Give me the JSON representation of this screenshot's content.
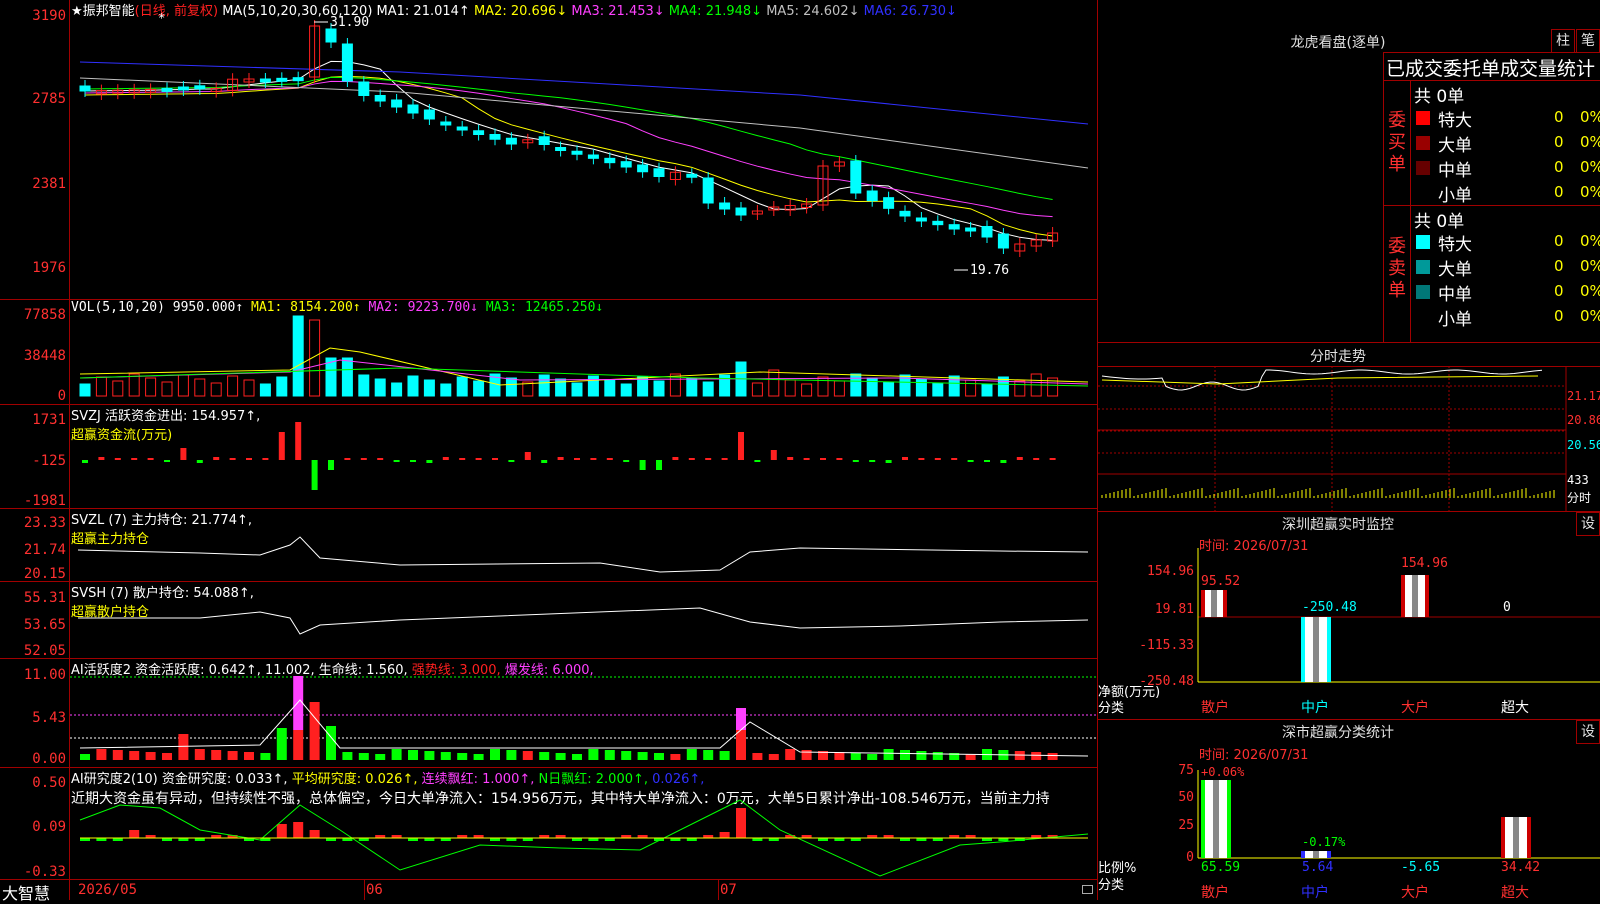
{
  "colors": {
    "up": "#ff2020",
    "down": "#00ffff",
    "ma1": "#ffffff",
    "ma2": "#ffff00",
    "ma3": "#ff40ff",
    "ma4": "#00ff00",
    "ma5": "#c0c0c0",
    "ma6": "#3030ff"
  },
  "main": {
    "title": "★振邦智能",
    "period": "(日线, 前复权)",
    "ma_label": "MA(5,10,20,30,60,120)",
    "ma1": "MA1: 21.014↑",
    "ma2": "MA2: 20.696↓",
    "ma3": "MA3: 21.453↓",
    "ma4": "MA4: 21.948↓",
    "ma5": "MA5: 24.602↓",
    "ma6": "MA6: 26.730↓",
    "y_labels": [
      "3190",
      "2785",
      "2381",
      "1976"
    ],
    "high_mark": "31.90",
    "low_mark": "19.76"
  },
  "vol": {
    "label": "VOL(5,10,20)",
    "value": "9950.000↑",
    "ma1": "MA1: 8154.200↑",
    "ma2": "MA2: 9223.700↓",
    "ma3": "MA3: 12465.250↓",
    "y_labels": [
      "77858",
      "38448",
      "0"
    ]
  },
  "svzj": {
    "label": "SVZJ 活跃资金进出: 154.957↑,",
    "sub": "超赢资金流(万元)",
    "y_labels": [
      "1731",
      "-125",
      "-1981"
    ]
  },
  "svzl": {
    "label": "SVZL (7) 主力持仓: 21.774↑,",
    "sub": "超赢主力持仓",
    "y_labels": [
      "23.33",
      "21.74",
      "20.15"
    ]
  },
  "svsh": {
    "label": "SVSH (7) 散户持仓: 54.088↑,",
    "sub": "超赢散户持仓",
    "y_labels": [
      "55.31",
      "53.65",
      "52.05"
    ]
  },
  "ai2": {
    "label": "AI活跃度2 资金活跃度: 0.642↑,",
    "v2": "11.002,",
    "v3": "生命线: 1.560,",
    "v4": "强势线: 3.000,",
    "v5": "爆发线: 6.000,",
    "y_labels": [
      "11.00",
      "5.43",
      "0.00"
    ]
  },
  "ai3": {
    "label": "AI研究度2(10) 资金研究度: 0.033↑,",
    "v2": "平均研究度: 0.026↑,",
    "v3": "连续飘红: 1.000↑,",
    "v4": "N日飘红: 2.000↑,",
    "v5": "0.026↑,",
    "note": "近期大资金虽有异动，但持续性不强，总体偏空，今日大单净流入：154.956万元，其中特大单净流入：0万元，大单5日累计净出-108.546万元，当前主力持",
    "y_labels": [
      "0.50",
      "0.09",
      "-0.33"
    ]
  },
  "xaxis": {
    "app": "大智慧",
    "labels": [
      "2026/05",
      "06",
      "07"
    ]
  },
  "dragon": {
    "title": "龙虎看盘(逐单)",
    "btn1": "柱",
    "btn2": "笔",
    "subtitle": "已成交委托单成交量统计",
    "buy": {
      "side": "委买单",
      "total": "共 0单",
      "rows": [
        {
          "name": "特大",
          "n": "0",
          "p": "0%",
          "c": "#ff0000"
        },
        {
          "name": "大单",
          "n": "0",
          "p": "0%",
          "c": "#990000"
        },
        {
          "name": "中单",
          "n": "0",
          "p": "0%",
          "c": "#660000"
        },
        {
          "name": "小单",
          "n": "0",
          "p": "0%",
          "c": ""
        }
      ]
    },
    "sell": {
      "side": "委卖单",
      "total": "共 0单",
      "rows": [
        {
          "name": "特大",
          "n": "0",
          "p": "0%",
          "c": "#00ffff"
        },
        {
          "name": "大单",
          "n": "0",
          "p": "0%",
          "c": "#009999"
        },
        {
          "name": "中单",
          "n": "0",
          "p": "0%",
          "c": "#007777"
        },
        {
          "name": "小单",
          "n": "0",
          "p": "0%",
          "c": ""
        }
      ]
    }
  },
  "fenshi": {
    "title": "分时走势",
    "y_labels": [
      "21.17",
      "20.86",
      "20.56"
    ],
    "vol_label": "433",
    "tail": "分时"
  },
  "sz_monitor": {
    "title": "深圳超赢实时监控",
    "btn": "设",
    "time": "时间: 2026/07/31",
    "y_labels": [
      "154.96",
      "19.81",
      "-115.33",
      "-250.48"
    ],
    "ylabel": "净额(万元)",
    "xlabel": "分类",
    "cats": [
      "散户",
      "中户",
      "大户",
      "超大"
    ],
    "values": [
      "95.52",
      "-250.48",
      "154.96",
      "0"
    ]
  },
  "sz_class": {
    "title": "深市超赢分类统计",
    "btn": "设",
    "time": "时间: 2026/07/31",
    "y_labels": [
      "75",
      "50",
      "25",
      "0"
    ],
    "ylabel": "比例%",
    "xlabel": "分类",
    "cats": [
      "散户",
      "中户",
      "大户",
      "超大"
    ],
    "top": [
      "+0.06%",
      "-0.17%",
      "",
      ""
    ],
    "bottom": [
      "65.59",
      "5.64",
      "-5.65",
      "34.42"
    ]
  }
}
